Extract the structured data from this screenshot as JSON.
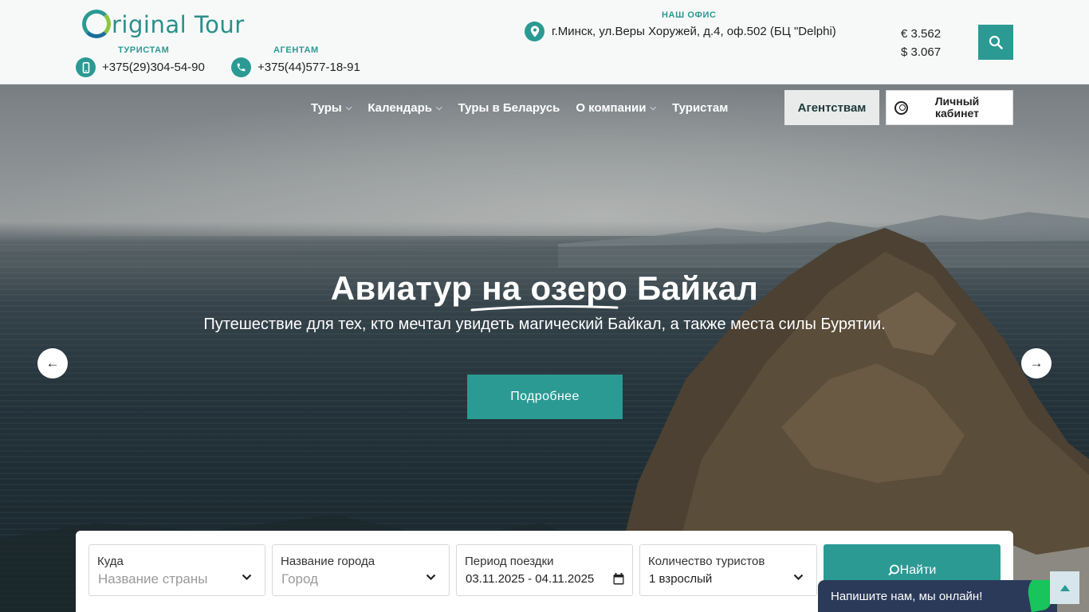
{
  "header": {
    "logo_text": "riginal Tour",
    "tourists_label": "ТУРИСТАМ",
    "tourists_phone": "+375(29)304-54-90",
    "agents_label": "АГЕНТАМ",
    "agents_phone": "+375(44)577-18-91",
    "office_label": "НАШ ОФИС",
    "office_address": "г.Минск, ул.Веры Хоружей, д.4, оф.502 (БЦ \"Delphi)",
    "rate_eur": "€ 3.562",
    "rate_usd": "$ 3.067"
  },
  "nav": {
    "items": [
      {
        "label": "Туры",
        "dropdown": true
      },
      {
        "label": "Календарь",
        "dropdown": true
      },
      {
        "label": "Туры в Беларусь",
        "dropdown": false
      },
      {
        "label": "О компании",
        "dropdown": true
      },
      {
        "label": "Туристам",
        "dropdown": false
      }
    ],
    "agents": "Агентствам",
    "cabinet_line1": "Личный",
    "cabinet_line2": "кабинет"
  },
  "hero": {
    "title": "Авиатур на озеро Байкал",
    "subtitle": "Путешествие для тех, кто мечтал увидеть магический Байкал, а также места силы Бурятии.",
    "button": "Подробнее",
    "prev_arrow": "←",
    "next_arrow": "→"
  },
  "search": {
    "where_label": "Куда",
    "where_placeholder": "Название страны",
    "city_label": "Название города",
    "city_placeholder": "Город",
    "period_label": "Период поездки",
    "period_value": "03.11.2025 - 04.11.2025",
    "tourists_label": "Количество туристов",
    "tourists_value": "1 взрослый",
    "find_button": "Найти"
  },
  "chat": {
    "text": "Напишите нам, мы онлайн!"
  },
  "colors": {
    "accent": "#2a9a93",
    "chat_bg": "#2c3a5a"
  }
}
